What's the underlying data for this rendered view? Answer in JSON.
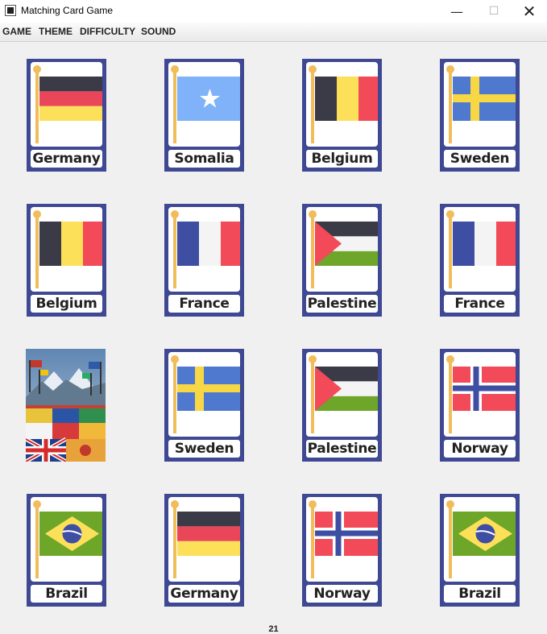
{
  "window": {
    "title": "Matching Card Game"
  },
  "menu": [
    "GAME",
    "THEME",
    "DIFFICULTY",
    "SOUND"
  ],
  "cards": [
    {
      "label": "Germany",
      "flag": "germany"
    },
    {
      "label": "Somalia",
      "flag": "somalia"
    },
    {
      "label": "Belgium",
      "flag": "belgium"
    },
    {
      "label": "Sweden",
      "flag": "sweden"
    },
    {
      "label": "Belgium",
      "flag": "belgium"
    },
    {
      "label": "France",
      "flag": "france"
    },
    {
      "label": "Palestine",
      "flag": "palestine"
    },
    {
      "label": "France",
      "flag": "france"
    },
    {
      "label": "",
      "flag": "card-back"
    },
    {
      "label": "Sweden",
      "flag": "sweden"
    },
    {
      "label": "Palestine",
      "flag": "palestine"
    },
    {
      "label": "Norway",
      "flag": "norway"
    },
    {
      "label": "Brazil",
      "flag": "brazil"
    },
    {
      "label": "Germany",
      "flag": "germany"
    },
    {
      "label": "Norway",
      "flag": "norway"
    },
    {
      "label": "Brazil",
      "flag": "brazil"
    }
  ],
  "score": "21",
  "colors": {
    "card_border": "#3f4893",
    "pole": "#f1bd5a"
  }
}
